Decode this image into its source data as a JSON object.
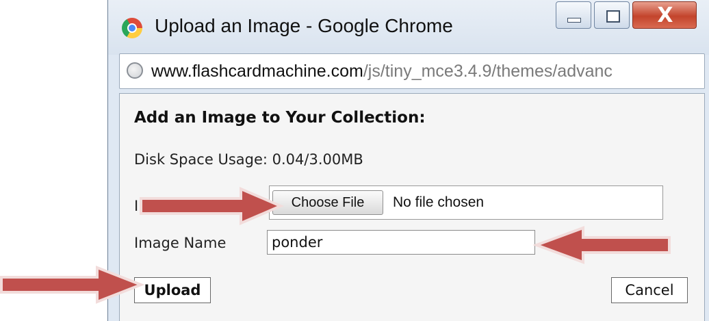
{
  "window": {
    "title": "Upload an Image - Google Chrome",
    "close_glyph": "X"
  },
  "address_bar": {
    "url_host": "www.flashcardmachine.com",
    "url_path": "/js/tiny_mce3.4.9/themes/advanc"
  },
  "form": {
    "heading": "Add an Image to Your Collection:",
    "disk_usage": "Disk Space Usage: 0.04/3.00MB",
    "image_label": "Image",
    "choose_file_label": "Choose File",
    "no_file_text": "No file chosen",
    "image_name_label": "Image Name",
    "image_name_value": "ponder",
    "upload_label": "Upload",
    "cancel_label": "Cancel"
  },
  "colors": {
    "arrow_fill": "#c0504d",
    "arrow_edge": "#f2dcdb",
    "close_button": "#c3442c"
  }
}
